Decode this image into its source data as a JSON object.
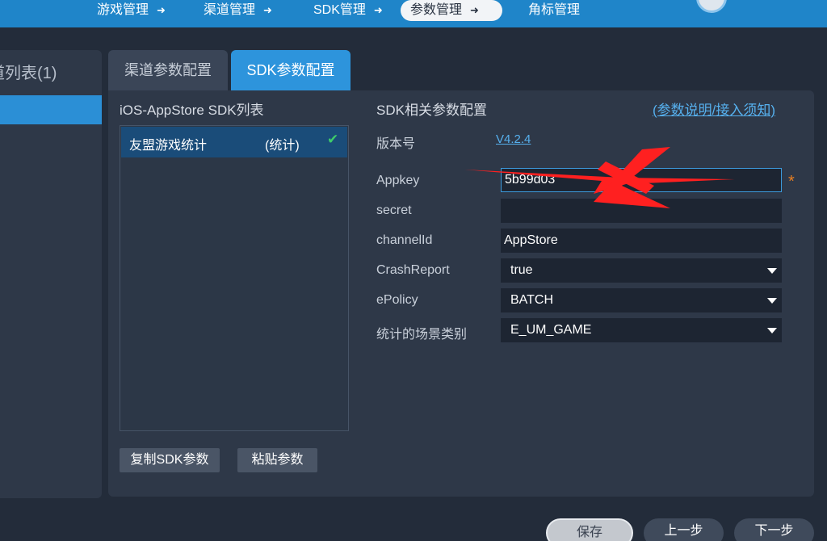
{
  "nav": {
    "steps": [
      {
        "label": "游戏管理"
      },
      {
        "label": "渠道管理"
      },
      {
        "label": "SDK管理"
      },
      {
        "label": "参数管理"
      },
      {
        "label": "角标管理"
      }
    ],
    "arrow": "➜"
  },
  "left": {
    "title": "道列表(1)"
  },
  "tabs": {
    "channel_params": "渠道参数配置",
    "sdk_params": "SDK参数配置"
  },
  "sdklist": {
    "title": "iOS-AppStore SDK列表",
    "items": [
      {
        "name": "友盟游戏统计",
        "tag": "(统计)",
        "check": "✔"
      }
    ]
  },
  "buttons": {
    "copy": "复制SDK参数",
    "paste": "粘贴参数"
  },
  "config": {
    "title": "SDK相关参数配置",
    "help_link": "(参数说明/接入须知)",
    "version_label": "版本号",
    "version_value": "V4.2.4",
    "fields": {
      "appkey_label": "Appkey",
      "appkey_value": "5b99d03",
      "secret_label": "secret",
      "secret_value": "",
      "channel_label": "channelId",
      "channel_value": "AppStore",
      "crash_label": "CrashReport",
      "crash_value": "true",
      "policy_label": "ePolicy",
      "policy_value": "BATCH",
      "scene_label": "统计的场景类别",
      "scene_value": "E_UM_GAME"
    },
    "required_mark": "*"
  },
  "footer": {
    "save": "保存",
    "prev": "上一步",
    "next": "下一步"
  },
  "colors": {
    "accent": "#2d94dc",
    "background": "#232c3a",
    "panel": "#2e3848",
    "required": "#e67e22",
    "annotation": "#ff2020"
  }
}
